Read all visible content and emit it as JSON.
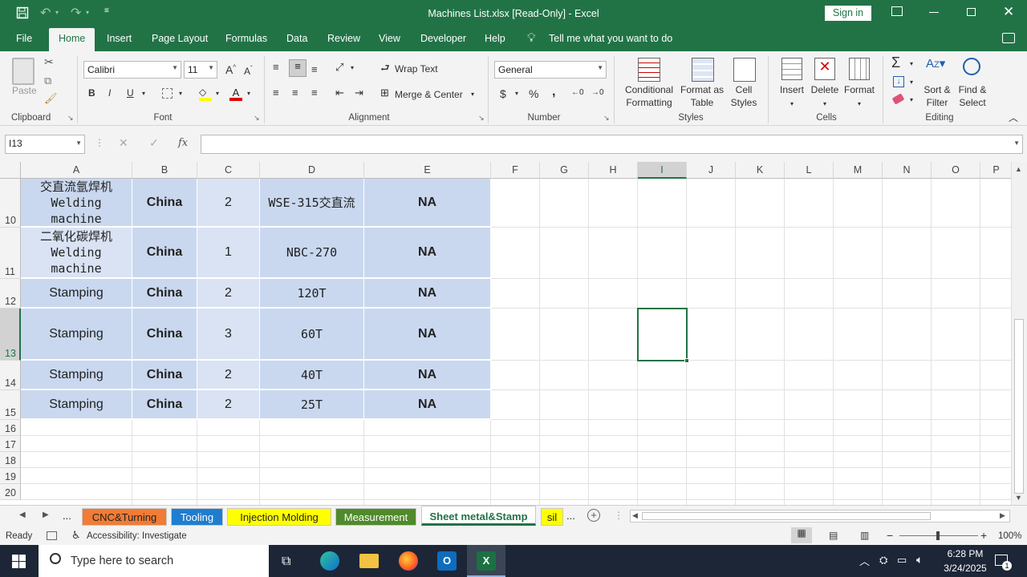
{
  "window": {
    "title": "Machines List.xlsx  [Read-Only]  -  Excel",
    "signin": "Sign in"
  },
  "menu": {
    "items": [
      "File",
      "Home",
      "Insert",
      "Page Layout",
      "Formulas",
      "Data",
      "Review",
      "View",
      "Developer",
      "Help"
    ],
    "tell_me": "Tell me what you want to do"
  },
  "ribbon": {
    "clipboard": {
      "label": "Clipboard",
      "paste": "Paste"
    },
    "font": {
      "label": "Font",
      "name": "Calibri",
      "size": "11",
      "bold": "B",
      "italic": "I",
      "underline": "U"
    },
    "alignment": {
      "label": "Alignment",
      "wrap": "Wrap Text",
      "merge": "Merge & Center"
    },
    "number": {
      "label": "Number",
      "format": "General",
      "currency": "$",
      "percent": "%",
      "comma": ","
    },
    "styles": {
      "label": "Styles",
      "conditional": "Conditional Formatting",
      "format_table": "Format as Table",
      "cell_styles": "Cell Styles"
    },
    "cells": {
      "label": "Cells",
      "insert": "Insert",
      "delete": "Delete",
      "format": "Format"
    },
    "editing": {
      "label": "Editing",
      "sort": "Sort & Filter",
      "find": "Find & Select"
    }
  },
  "formula": {
    "namebox": "I13",
    "fx": "fx",
    "value": ""
  },
  "columns": [
    "A",
    "B",
    "C",
    "D",
    "E",
    "F",
    "G",
    "H",
    "I",
    "J",
    "K",
    "L",
    "M",
    "N",
    "O",
    "P"
  ],
  "rows": [
    {
      "num": "10",
      "cells": [
        "交直流氩焊机Welding machine",
        "China",
        "2",
        "WSE-315交直流",
        "NA"
      ]
    },
    {
      "num": "11",
      "cells": [
        "二氧化碳焊机Welding machine",
        "China",
        "1",
        "NBC-270",
        "NA"
      ]
    },
    {
      "num": "12",
      "cells": [
        "Stamping",
        "China",
        "2",
        "120T",
        "NA"
      ]
    },
    {
      "num": "13",
      "cells": [
        "Stamping",
        "China",
        "3",
        "60T",
        "NA"
      ]
    },
    {
      "num": "14",
      "cells": [
        "Stamping",
        "China",
        "2",
        "40T",
        "NA"
      ]
    },
    {
      "num": "15",
      "cells": [
        "Stamping",
        "China",
        "2",
        "25T",
        "NA"
      ]
    },
    {
      "num": "16",
      "cells": [
        "",
        "",
        "",
        "",
        ""
      ]
    },
    {
      "num": "17",
      "cells": [
        "",
        "",
        "",
        "",
        ""
      ]
    },
    {
      "num": "18",
      "cells": [
        "",
        "",
        "",
        "",
        ""
      ]
    },
    {
      "num": "19",
      "cells": [
        "",
        "",
        "",
        "",
        ""
      ]
    },
    {
      "num": "20",
      "cells": [
        "",
        "",
        "",
        "",
        ""
      ]
    }
  ],
  "sheets": [
    {
      "name": "CNC&Turning",
      "color": "#f07c35"
    },
    {
      "name": "Tooling",
      "color": "#1f7dcf"
    },
    {
      "name": "Injection Molding",
      "color": "#ffff00"
    },
    {
      "name": "Measurement",
      "color": "#4f8a2b"
    },
    {
      "name": "Sheet metal&Stamp",
      "color": "#ffffff"
    },
    {
      "name": "sil",
      "color": "#ffff00"
    }
  ],
  "sheet_more": "...",
  "status": {
    "ready": "Ready",
    "accessibility": "Accessibility: Investigate",
    "zoom": "100%"
  },
  "taskbar": {
    "search": "Type here to search",
    "time": "6:28 PM",
    "date": "3/24/2025",
    "notifications": "1"
  },
  "colors": {
    "accent": "#217346",
    "cell_fill_light": "#dae3f3",
    "cell_fill_dark": "#c9d8ef"
  }
}
